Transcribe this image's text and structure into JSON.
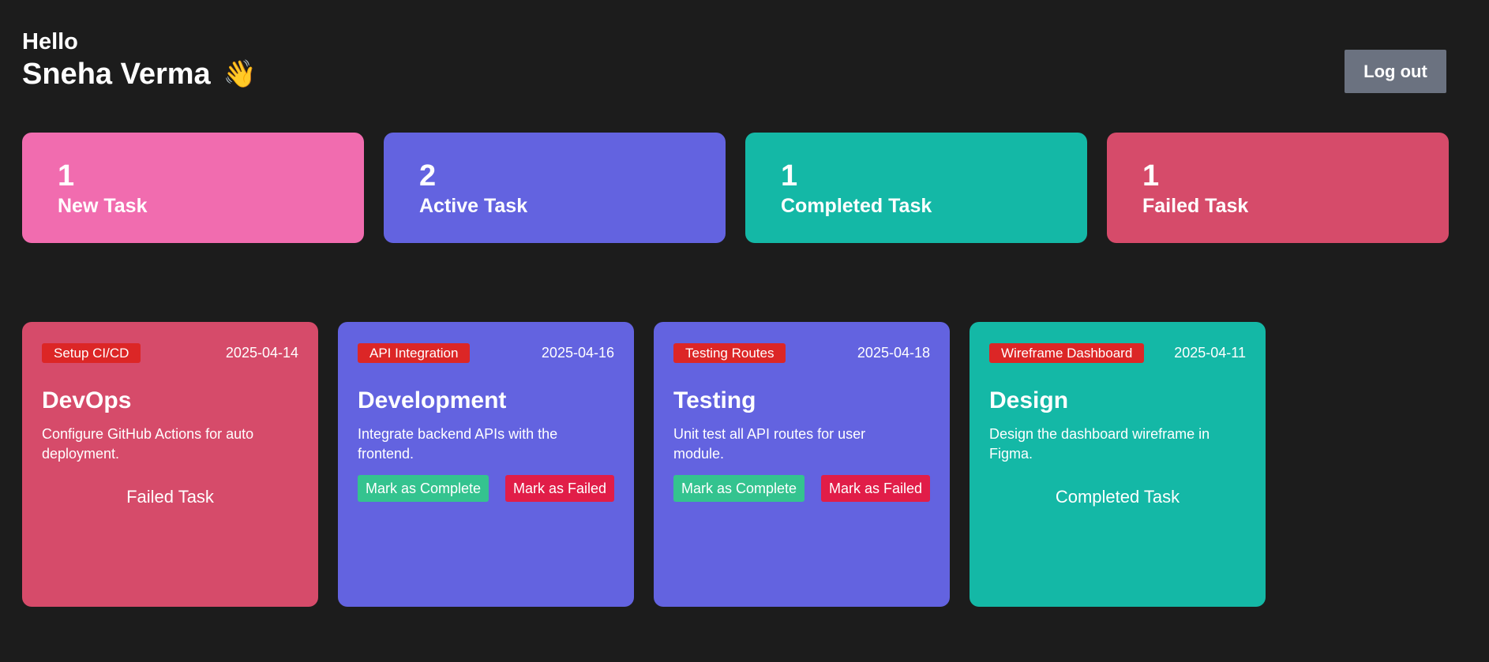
{
  "header": {
    "greeting": "Hello",
    "name": "Sneha Verma",
    "wave_emoji": "👋",
    "logout_label": "Log out"
  },
  "stats": [
    {
      "count": "1",
      "label": "New Task",
      "color": "#f16caf"
    },
    {
      "count": "2",
      "label": "Active Task",
      "color": "#6363e0"
    },
    {
      "count": "1",
      "label": "Completed Task",
      "color": "#14b8a6"
    },
    {
      "count": "1",
      "label": "Failed Task",
      "color": "#d64b6a"
    }
  ],
  "tasks": [
    {
      "category": "Setup CI/CD",
      "date": "2025-04-14",
      "title": "DevOps",
      "description": "Configure GitHub Actions for auto deployment.",
      "status": "Failed Task",
      "color": "#d64b6a"
    },
    {
      "category": "API Integration",
      "date": "2025-04-16",
      "title": "Development",
      "description": "Integrate backend APIs with the frontend.",
      "complete_label": "Mark as Complete",
      "failed_label": "Mark as Failed",
      "color": "#6363e0"
    },
    {
      "category": "Testing Routes",
      "date": "2025-04-18",
      "title": "Testing",
      "description": "Unit test all API routes for user module.",
      "complete_label": "Mark as Complete",
      "failed_label": "Mark as Failed",
      "color": "#6363e0"
    },
    {
      "category": "Wireframe Dashboard",
      "date": "2025-04-11",
      "title": "Design",
      "description": "Design the dashboard wireframe in Figma.",
      "status": "Completed Task",
      "color": "#14b8a6"
    }
  ]
}
